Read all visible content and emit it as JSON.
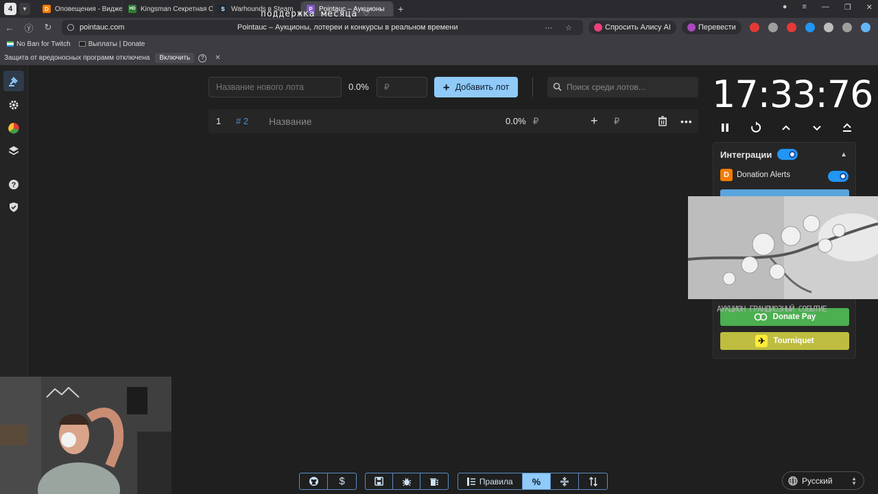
{
  "browser": {
    "tab_count": "4",
    "tabs": [
      {
        "label": "Оповещения - Виджеты",
        "fav_color": "#f57c00",
        "fav_char": "D"
      },
      {
        "label": "Kingsman Секретная Слу",
        "fav_color": "#2e7d32",
        "fav_char": "HD"
      },
      {
        "label": "Warhounds в Steam",
        "fav_color": "#1b2838",
        "fav_char": "S"
      },
      {
        "label": "Pointauc – Аукционы",
        "fav_color": "#7e57c2",
        "fav_char": "P",
        "active": true
      }
    ],
    "overlay_text": "поддержка месяца ♡",
    "url_domain": "pointauc.com",
    "page_title": "Pointauc – Аукционы, лотереи и конкурсы в реальном времени",
    "alice_button": "Спросить Алису AI",
    "translate_button": "Перевести",
    "bookmarks": [
      {
        "label": "No Ban for Twitch"
      },
      {
        "label": "Выплаты | Donate"
      }
    ],
    "security_text": "Защита от вредоносных программ отключена",
    "security_enable": "Включить",
    "icons": [
      "back-icon",
      "forward-icon",
      "reload-icon",
      "lock-icon",
      "bookmark-icon",
      "more-icon"
    ]
  },
  "sidebar": {
    "items": [
      {
        "name": "auction-icon",
        "active": true
      },
      {
        "name": "settings-icon"
      },
      {
        "name": "statistics-icon"
      },
      {
        "name": "layers-icon"
      },
      {
        "name": "help-icon"
      },
      {
        "name": "shield-icon"
      }
    ]
  },
  "controls": {
    "new_lot_placeholder": "Название нового лота",
    "new_lot_percent": "0.0%",
    "amount_placeholder": "₽",
    "add_button": "Добавить лот",
    "search_placeholder": "Поиск среди лотов..."
  },
  "lots": [
    {
      "number": "1",
      "id": "# 2",
      "name": "Название",
      "percent": "0.0%",
      "currency": "₽",
      "plus": "+",
      "currency2": "₽",
      "more": "•••"
    }
  ],
  "timer": {
    "value": "17:33:76",
    "controls": [
      "pause-icon",
      "restart-icon",
      "increase-icon",
      "decrease-icon",
      "double-increase-icon"
    ]
  },
  "integrations": {
    "title": "Интеграции",
    "enabled": true,
    "donation_alerts": {
      "label": "Donation Alerts",
      "enabled": true
    },
    "donate_pay": "Donate Pay",
    "tourniquet": "Tourniquet"
  },
  "overlay": {
    "caption": "АУКЦИОН ГРАНДИОЗНЫЙ СОБЫТИЕ"
  },
  "bottom_toolbar": {
    "rules_label": "Правила",
    "buttons": [
      "github-icon",
      "dollar-icon",
      "save-icon",
      "bug-icon",
      "delete-all-icon",
      "rules-icon",
      "percent-icon",
      "collapse-icon",
      "sort-icon"
    ]
  },
  "language": {
    "label": "Русский"
  },
  "colors": {
    "accent": "#90caf9",
    "toggle": "#2196f3",
    "donate_pay": "#4caf50",
    "tourniquet": "#bfbd3f"
  }
}
